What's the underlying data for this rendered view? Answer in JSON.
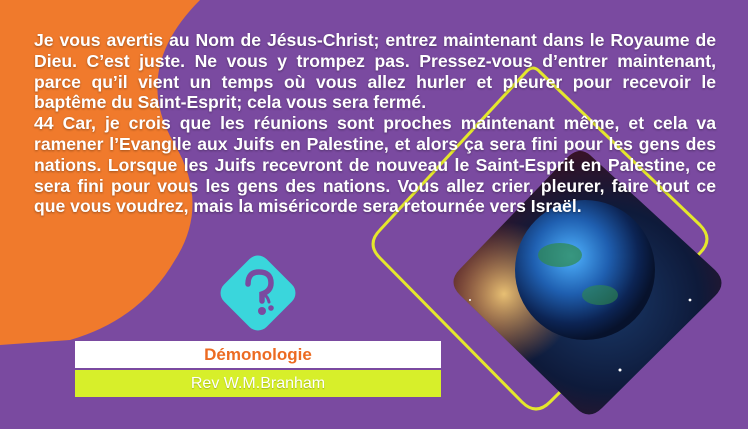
{
  "quote": {
    "paragraph_1": "Je vous avertis au Nom de Jésus-Christ; entrez maintenant dans le Royaume de Dieu. C’est juste. Ne vous y trompez pas. Pressez-vous d’entrer maintenant, parce qu’il vient un temps où vous allez hurler et pleurer pour recevoir le baptême du Saint-Esprit; cela vous sera fermé.",
    "paragraph_2": "44 Car, je crois que les réunions sont proches maintenant même, et cela va ramener l’Evangile aux Juifs en Palestine, et alors ça sera fini pour les gens des nations. Lorsque les Juifs recevront de nouveau le Saint-Esprit en Palestine, ce sera fini pour vous les gens des nations. Vous allez crier, pleurer, faire tout ce que vous voudrez, mais la miséricorde sera retournée vers Israël."
  },
  "category_label": "Démonologie",
  "author_label": "Rev W.M.Branham",
  "colors": {
    "background": "#7a4aa0",
    "orange": "#f07a2c",
    "yellow": "#e4e72c",
    "cyan": "#3ad6dc",
    "title_text": "#ec6b22",
    "author_bar": "#d7ef2a"
  }
}
